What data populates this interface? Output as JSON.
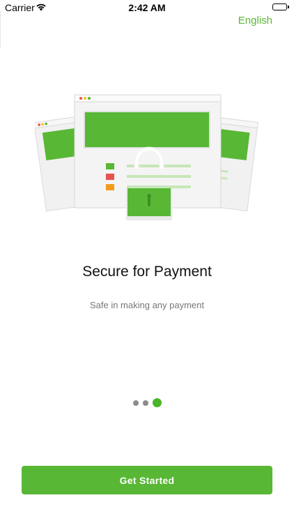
{
  "status_bar": {
    "carrier": "Carrier",
    "time": "2:42 AM"
  },
  "header": {
    "language_label": "English"
  },
  "onboarding": {
    "title": "Secure for Payment",
    "subtitle": "Safe in making any payment",
    "page_index": 3,
    "page_count": 3,
    "cta_label": "Get Started"
  },
  "colors": {
    "accent": "#58b735",
    "indicator_inactive": "#8c8c8c",
    "illustration_red": "#e9534f",
    "illustration_orange": "#f29c1d"
  },
  "icons": {
    "illustration": "secure-payment-illustration"
  }
}
